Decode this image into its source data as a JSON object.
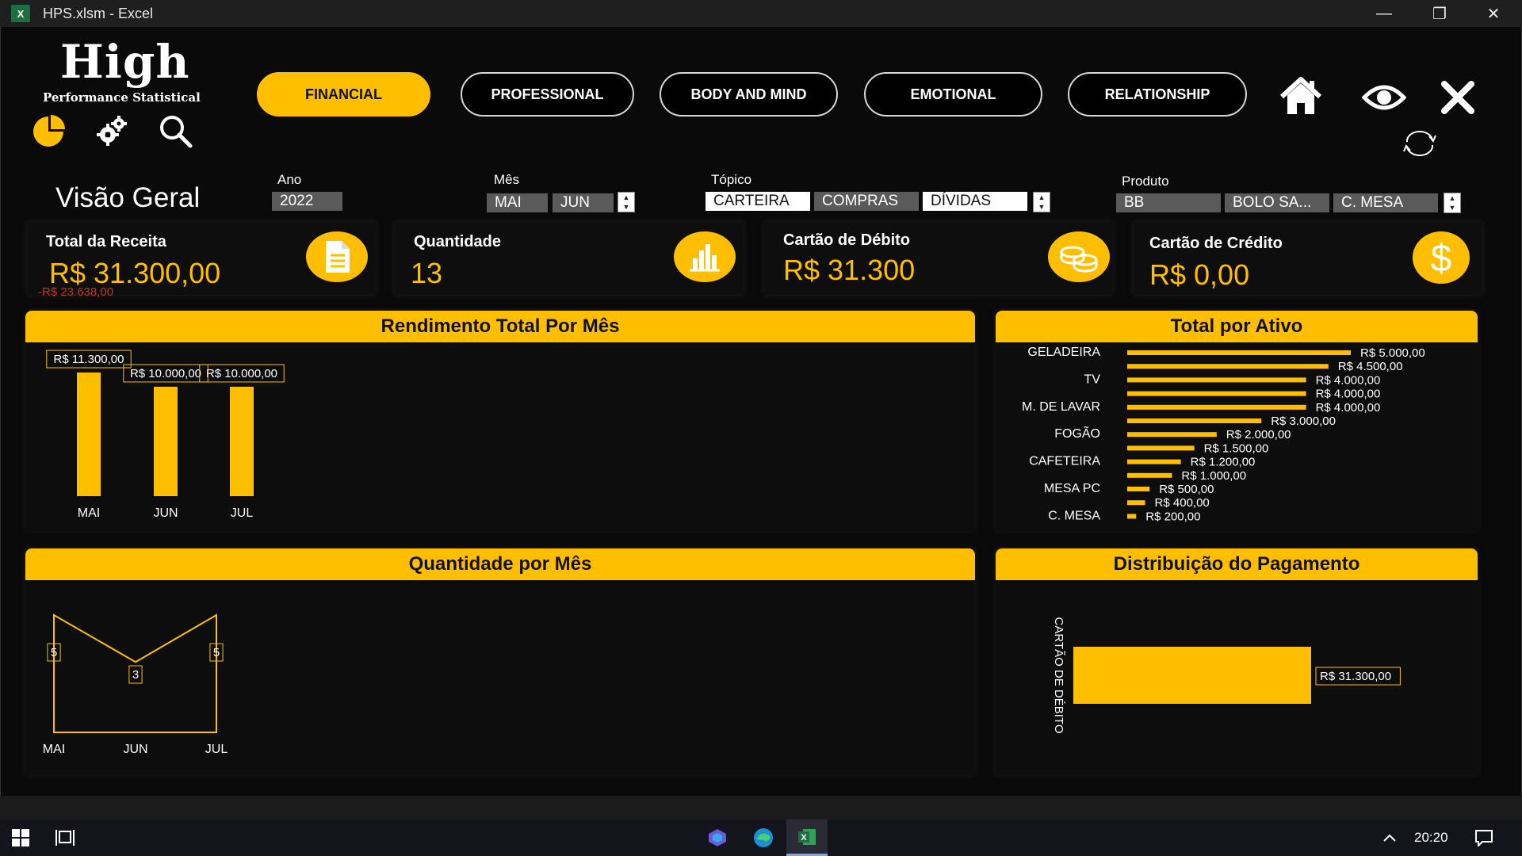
{
  "window": {
    "title": "HPS.xlsm - Excel",
    "app_badge": "X",
    "minimize": "—",
    "restore": "❐",
    "close": "✕"
  },
  "logo": {
    "title": "High",
    "subtitle": "Performance Statistical"
  },
  "toolbar": {
    "icons": [
      "pie-chart-icon",
      "gear-icon",
      "search-icon"
    ]
  },
  "nav": {
    "tabs": [
      {
        "label": "FINANCIAL",
        "active": true
      },
      {
        "label": "PROFESSIONAL",
        "active": false
      },
      {
        "label": "BODY AND MIND",
        "active": false
      },
      {
        "label": "EMOTIONAL",
        "active": false
      },
      {
        "label": "RELATIONSHIP",
        "active": false
      }
    ],
    "icons": [
      "home-icon",
      "eye-icon",
      "close-icon",
      "refresh-icon"
    ]
  },
  "filters": {
    "heading": "Visão Geral",
    "ano": {
      "label": "Ano",
      "items": [
        "2022"
      ]
    },
    "mes": {
      "label": "Mês",
      "items": [
        "MAI",
        "JUN"
      ]
    },
    "topico": {
      "label": "Tópico",
      "items": [
        {
          "text": "CARTEIRA",
          "selected": true
        },
        {
          "text": "COMPRAS",
          "selected": false
        },
        {
          "text": "DÍVIDAS",
          "selected": true
        }
      ]
    },
    "produto": {
      "label": "Produto",
      "items": [
        "BB",
        "BOLO SA...",
        "C. MESA"
      ]
    }
  },
  "kpis": [
    {
      "label": "Total da Receita",
      "value": "R$ 31.300,00",
      "sub": "-R$ 23.638,00",
      "icon": "document-icon"
    },
    {
      "label": "Quantidade",
      "value": "13",
      "icon": "bar-chart-icon"
    },
    {
      "label": "Cartão de Débito",
      "value": "R$ 31.300",
      "icon": "coins-icon"
    },
    {
      "label": "Cartão de Crédito",
      "value": "R$ 0,00",
      "icon": "dollar-icon"
    }
  ],
  "colors": {
    "accent": "#ffbf00",
    "background": "#0a0a0a",
    "negative": "#c0392b"
  },
  "chart_data": [
    {
      "type": "bar",
      "title": "Rendimento Total Por Mês",
      "categories": [
        "MAI",
        "JUN",
        "JUL"
      ],
      "values": [
        11300,
        10000,
        10000
      ],
      "data_labels": [
        "R$ 11.300,00",
        "R$ 10.000,00",
        "R$ 10.000,00"
      ],
      "ylim": [
        0,
        11300
      ]
    },
    {
      "type": "bar",
      "orientation": "horizontal",
      "title": "Total por Ativo",
      "categories": [
        "GELADEIRA",
        "",
        "TV",
        "",
        "M. DE LAVAR",
        "",
        "FOGÃO",
        "",
        "CAFETEIRA",
        "",
        "MESA PC",
        "",
        "C. MESA"
      ],
      "values": [
        5000,
        4500,
        4000,
        4000,
        4000,
        3000,
        2000,
        1500,
        1200,
        1000,
        500,
        400,
        200
      ],
      "data_labels": [
        "R$ 5.000,00",
        "R$ 4.500,00",
        "R$ 4.000,00",
        "R$ 4.000,00",
        "R$ 4.000,00",
        "R$ 3.000,00",
        "R$ 2.000,00",
        "R$ 1.500,00",
        "R$ 1.200,00",
        "R$ 1.000,00",
        "R$ 500,00",
        "R$ 400,00",
        "R$ 200,00"
      ]
    },
    {
      "type": "area",
      "title": "Quantidade por Mês",
      "categories": [
        "MAI",
        "JUN",
        "JUL"
      ],
      "values": [
        5,
        3,
        5
      ],
      "data_labels": [
        "5",
        "3",
        "5"
      ],
      "ylim": [
        0,
        5
      ]
    },
    {
      "type": "bar",
      "orientation": "horizontal",
      "title": "Distribuição do Pagamento",
      "categories": [
        "CARTÃO DE DÉBITO"
      ],
      "values": [
        31300
      ],
      "data_labels": [
        "R$ 31.300,00"
      ]
    }
  ],
  "taskbar": {
    "time": "20:20",
    "icons": [
      "windows-start-icon",
      "task-view-icon",
      "copilot-icon",
      "edge-icon",
      "excel-taskbar-icon",
      "chevron-up-icon",
      "notification-icon"
    ]
  }
}
